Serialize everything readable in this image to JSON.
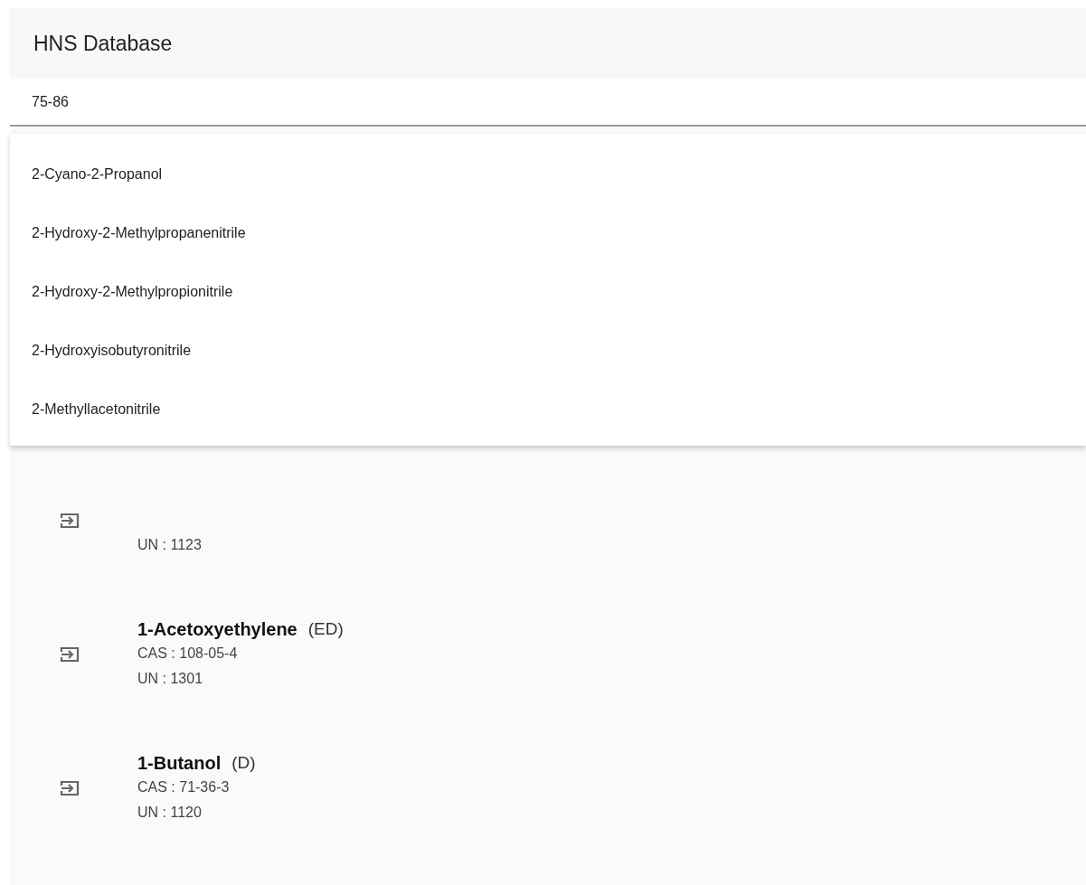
{
  "header": {
    "title": "HNS Database"
  },
  "search": {
    "value": "75-86"
  },
  "suggestions": [
    {
      "label": "2-Cyano-2-Propanol"
    },
    {
      "label": "2-Hydroxy-2-Methylpropanenitrile"
    },
    {
      "label": "2-Hydroxy-2-Methylpropionitrile"
    },
    {
      "label": "2-Hydroxyisobutyronitrile"
    },
    {
      "label": "2-Methyllacetonitrile"
    }
  ],
  "results": [
    {
      "un": "UN : 1123"
    },
    {
      "name": "1-Acetoxyethylene",
      "code": "(ED)",
      "cas": "CAS : 108-05-4",
      "un": "UN : 1301"
    },
    {
      "name": "1-Butanol",
      "code": "(D)",
      "cas": "CAS : 71-36-3",
      "un": "UN : 1120"
    }
  ]
}
